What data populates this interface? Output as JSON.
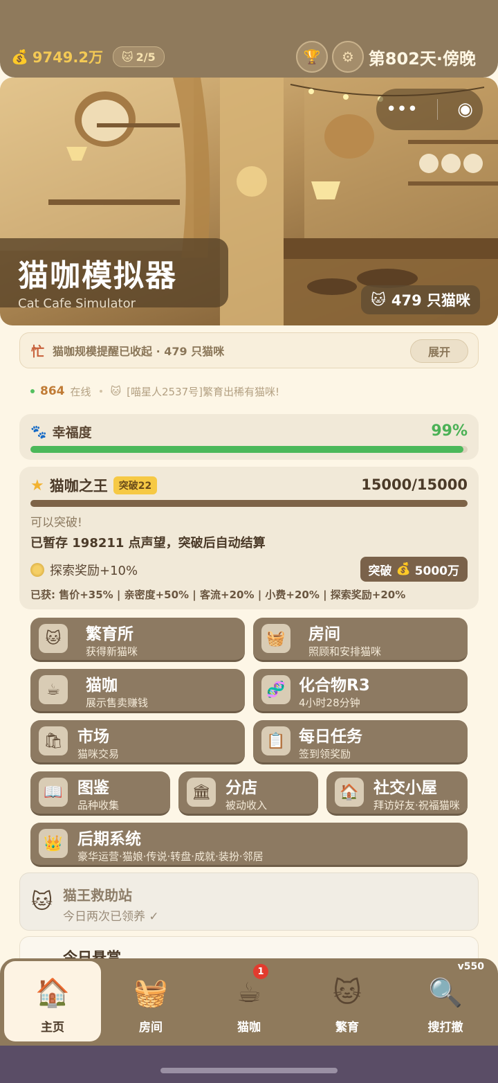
{
  "topbar": {
    "money": "9749.2万",
    "cat_slots": "2/5",
    "day_text": "第802天·傍晚",
    "icons": [
      "money-bag-icon",
      "cat-face-icon",
      "trophy-icon",
      "settings-gear-icon"
    ]
  },
  "hero": {
    "title_cn": "猫咖模拟器",
    "title_en": "Cat Cafe Simulator",
    "cats_badge": "479 只猫咪",
    "capsule_icons": [
      "more-dots-icon",
      "close-circle-icon"
    ]
  },
  "notice": {
    "busy_label": "忙",
    "text": "猫咖规模提醒已收起 · 479 只猫咪",
    "expand_label": "展开"
  },
  "online": {
    "count": "864",
    "label": "在线",
    "broadcast": "[喵星人2537号]繁育出稀有猫咪!"
  },
  "happiness": {
    "label": "幸福度",
    "value": "99%",
    "fraction": 0.99
  },
  "king": {
    "title": "猫咖之王",
    "break_tag": "突破22",
    "score": "15000/15000",
    "fraction": 1.0,
    "can_break": "可以突破!",
    "stored": "已暂存 198211 点声望，突破后自动结算",
    "bonus": "探索奖励+10%",
    "break_button": "突破",
    "break_cost": "5000万",
    "gained": "已获: 售价+35% | 亲密度+50% | 客流+20% | 小费+20% | 探索奖励+20%"
  },
  "menu": [
    {
      "title": "繁育所",
      "sub": "获得新猫咪",
      "icon": "cat-couple-icon"
    },
    {
      "title": "房间",
      "sub": "照顾和安排猫咪",
      "icon": "cat-bed-icon"
    },
    {
      "title": "猫咖",
      "sub": "展示售卖赚钱",
      "icon": "cat-cup-icon"
    },
    {
      "title": "化合物R3",
      "sub": "4小时28分钟",
      "icon": "dna-icon"
    },
    {
      "title": "市场",
      "sub": "猫咪交易",
      "icon": "shopping-bag-icon"
    },
    {
      "title": "每日任务",
      "sub": "签到领奖励",
      "icon": "clipboard-icon"
    },
    {
      "title": "图鉴",
      "sub": "品种收集",
      "icon": "book-icon"
    },
    {
      "title": "分店",
      "sub": "被动收入",
      "icon": "building-icon"
    },
    {
      "title": "社交小屋",
      "sub": "拜访好友·祝福猫咪",
      "icon": "cabin-icon"
    },
    {
      "title": "后期系统",
      "sub": "豪华运营·猫娘·传说·转盘·成就·装扮·邻居",
      "icon": "crown-icon"
    }
  ],
  "rescue": {
    "title": "猫王救助站",
    "sub": "今日两次已领养 ✓"
  },
  "bounty": {
    "title": "今日悬赏"
  },
  "nav": {
    "items": [
      {
        "label": "主页",
        "icon": "house-icon"
      },
      {
        "label": "房间",
        "icon": "cat-bed-icon"
      },
      {
        "label": "猫咖",
        "icon": "cat-cup-icon"
      },
      {
        "label": "繁育",
        "icon": "cat-couple-icon"
      },
      {
        "label": "搜打撤",
        "icon": "magnifier-map-icon"
      }
    ],
    "badge": "1",
    "version": "v550"
  }
}
